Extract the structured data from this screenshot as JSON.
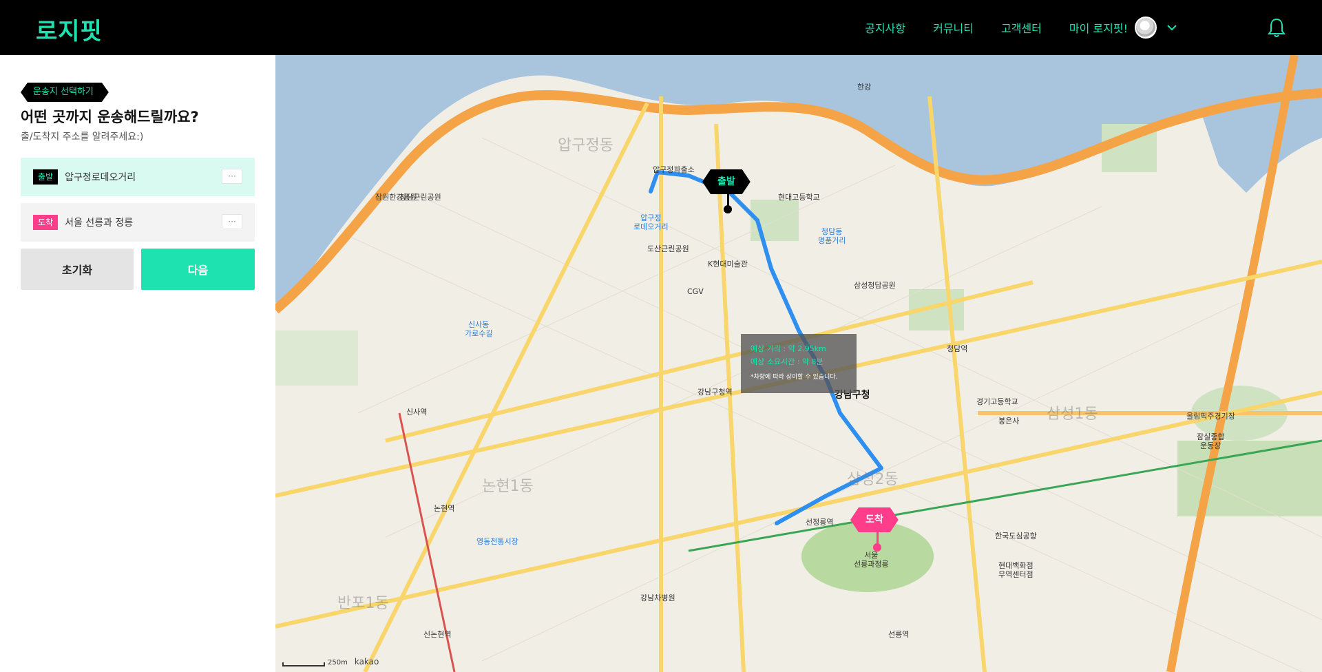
{
  "header": {
    "logo": "로지핏",
    "nav": [
      "공지사항",
      "커뮤니티",
      "고객센터"
    ],
    "my_label": "마이 로지핏!"
  },
  "sidebar": {
    "step_tag": "운송지 선택하기",
    "title": "어떤 곳까지 운송해드릴까요?",
    "subtitle": "출/도착지 주소를 알려주세요:)",
    "start": {
      "badge": "출발",
      "address": "압구정로데오거리"
    },
    "end": {
      "badge": "도착",
      "address": "서울 선릉과 정릉"
    },
    "more_label": "···",
    "reset_label": "초기화",
    "next_label": "다음"
  },
  "map": {
    "start_marker": "출발",
    "end_marker": "도착",
    "info": {
      "distance": "예상 거리 : 약 2.95km",
      "time": "예상 소요시간 : 약 8분",
      "note": "*차량에 따라 상이할 수 있습니다."
    },
    "scale_label": "250m",
    "provider": "kakao",
    "labels": [
      {
        "text": "압구정\n로데오거리",
        "cls": "blue"
      },
      {
        "text": "강남구청",
        "cls": "big"
      },
      {
        "text": "서울\n선릉과정릉",
        "cls": ""
      },
      {
        "text": "압구정동",
        "cls": "district"
      },
      {
        "text": "논현1동",
        "cls": "district"
      },
      {
        "text": "삼성1동",
        "cls": "district"
      },
      {
        "text": "삼성2동",
        "cls": "district"
      },
      {
        "text": "반포1동",
        "cls": "district"
      },
      {
        "text": "한강",
        "cls": ""
      },
      {
        "text": "신사역",
        "cls": ""
      },
      {
        "text": "논현역",
        "cls": ""
      },
      {
        "text": "강남구청역",
        "cls": ""
      },
      {
        "text": "선정릉역",
        "cls": ""
      },
      {
        "text": "선릉역",
        "cls": ""
      },
      {
        "text": "신논현역",
        "cls": ""
      },
      {
        "text": "청담역",
        "cls": ""
      },
      {
        "text": "도산근린공원",
        "cls": ""
      },
      {
        "text": "K현대미술관",
        "cls": ""
      },
      {
        "text": "CGV",
        "cls": ""
      },
      {
        "text": "신사동\n가로수길",
        "cls": "blue"
      },
      {
        "text": "영동전통시장",
        "cls": "blue"
      },
      {
        "text": "청담동\n명품거리",
        "cls": "blue"
      },
      {
        "text": "현대고등학교",
        "cls": ""
      },
      {
        "text": "삼성청담공원",
        "cls": ""
      },
      {
        "text": "청담근린공원",
        "cls": ""
      },
      {
        "text": "압구정파출소",
        "cls": ""
      },
      {
        "text": "강남차병원",
        "cls": ""
      },
      {
        "text": "봉은사",
        "cls": ""
      },
      {
        "text": "한국도심공항",
        "cls": ""
      },
      {
        "text": "경기고등학교",
        "cls": ""
      },
      {
        "text": "잠원한강공원",
        "cls": ""
      },
      {
        "text": "올림픽주경기장",
        "cls": ""
      },
      {
        "text": "잠실종합\n운동장",
        "cls": ""
      },
      {
        "text": "현대백화점\n무역센터점",
        "cls": ""
      }
    ]
  }
}
